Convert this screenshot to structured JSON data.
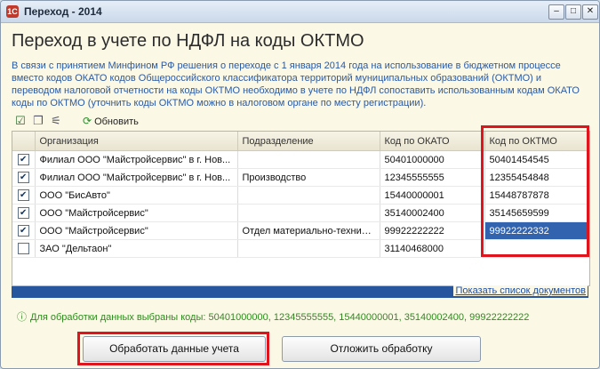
{
  "window": {
    "title": "Переход - 2014"
  },
  "heading": "Переход в учете по НДФЛ на коды ОКТМО",
  "description": "В связи с принятием Минфином РФ решения о переходе с 1 января 2014 года на использование в бюджетном процессе вместо кодов ОКАТО кодов Общероссийского классификатора территорий муниципальных образований (ОКТМО) и переводом налоговой отчетности на коды ОКТМО необходимо в учете по НДФЛ сопоставить использованным кодам ОКАТО коды по ОКТМО (уточнить коды ОКТМО можно в налоговом органе по месту регистрации).",
  "toolbar": {
    "refresh_label": "Обновить"
  },
  "table": {
    "columns": [
      "",
      "Организация",
      "Подразделение",
      "Код по ОКАТО",
      "Код по ОКТМО"
    ],
    "rows": [
      {
        "checked": true,
        "org": "Филиал ООО \"Майстройсервис\" в г. Нов...",
        "dept": "",
        "okato": "50401000000",
        "oktmo": "50401454545"
      },
      {
        "checked": true,
        "org": "Филиал ООО \"Майстройсервис\" в г. Нов...",
        "dept": "Производство",
        "okato": "12345555555",
        "oktmo": "12355454848"
      },
      {
        "checked": true,
        "org": "ООО \"БисАвто\"",
        "dept": "",
        "okato": "15440000001",
        "oktmo": "15448787878"
      },
      {
        "checked": true,
        "org": "ООО \"Майстройсервис\"",
        "dept": "",
        "okato": "35140002400",
        "oktmo": "35145659599"
      },
      {
        "checked": true,
        "org": "ООО \"Майстройсервис\"",
        "dept": "Отдел материально-технич...",
        "okato": "99922222222",
        "oktmo": "99922222332"
      },
      {
        "checked": false,
        "org": "ЗАО \"Дельтаон\"",
        "dept": "",
        "okato": "31140468000",
        "oktmo": ""
      }
    ]
  },
  "show_docs_link": "Показать список документов",
  "summary": "Для обработки данных выбраны коды: 50401000000, 12345555555, 15440000001, 35140002400, 99922222222",
  "buttons": {
    "process": "Обработать данные учета",
    "postpone": "Отложить обработку"
  },
  "colors": {
    "highlight": "#e0141c",
    "accent_blue": "#27569f",
    "info_text": "#2a5aa5",
    "summary_text": "#2f8b1e"
  }
}
